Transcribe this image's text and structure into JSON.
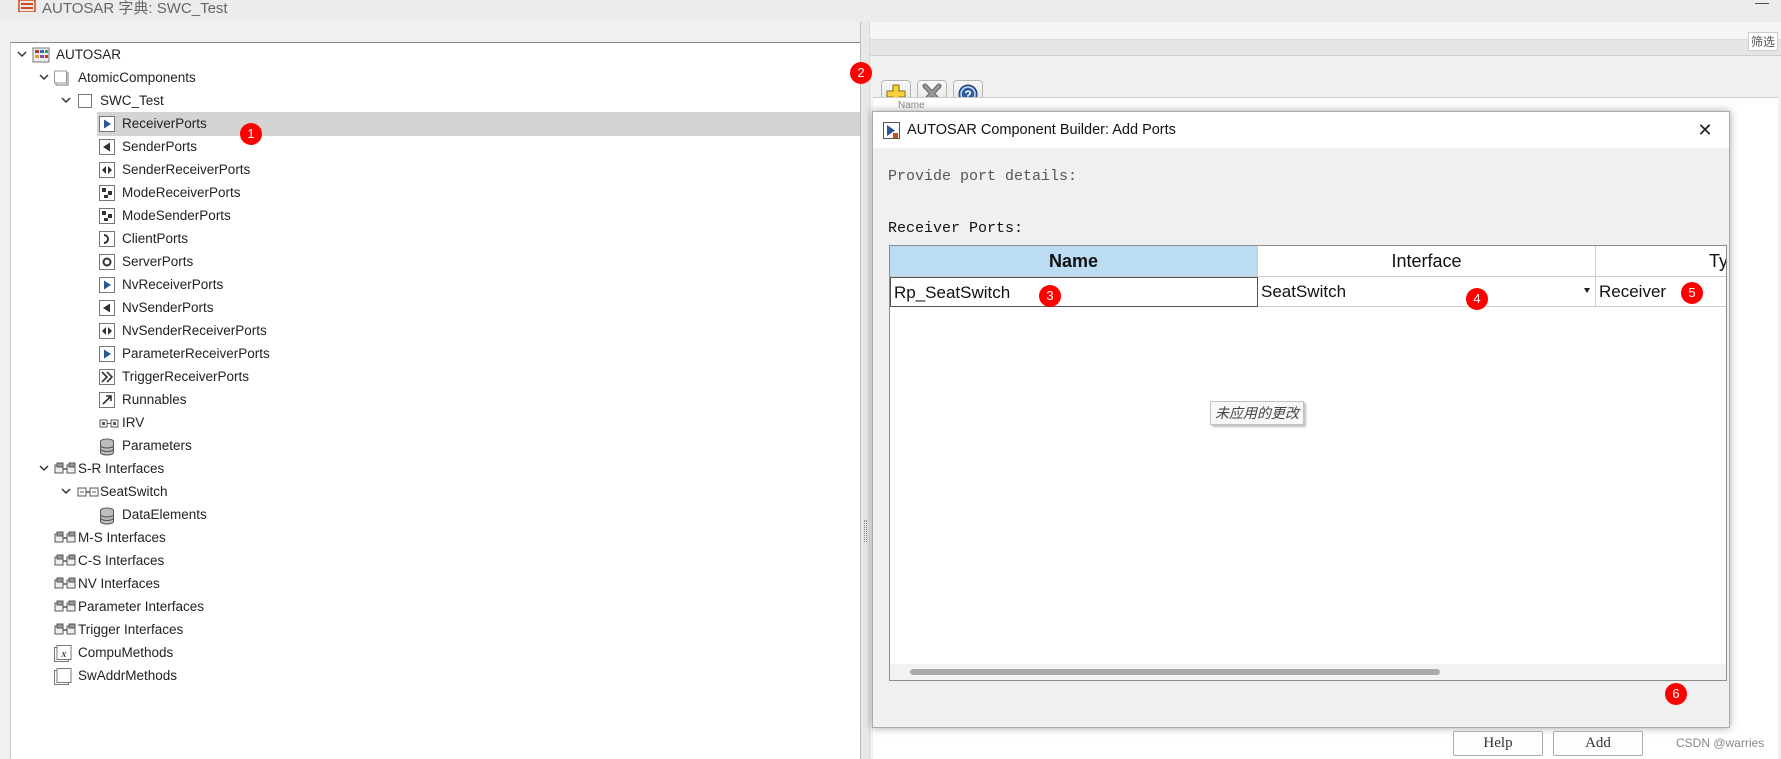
{
  "window": {
    "title": "AUTOSAR 字典: SWC_Test"
  },
  "tree": {
    "items": [
      {
        "label": "AUTOSAR",
        "depth": 0,
        "expander": "expanded",
        "icon": "autosar-root-icon",
        "selected": false
      },
      {
        "label": "AtomicComponents",
        "depth": 1,
        "expander": "expanded",
        "icon": "package-icon",
        "selected": false
      },
      {
        "label": "SWC_Test",
        "depth": 2,
        "expander": "expanded",
        "icon": "component-icon",
        "selected": false
      },
      {
        "label": "ReceiverPorts",
        "depth": 3,
        "expander": "none",
        "icon": "receiver-port-icon",
        "selected": true
      },
      {
        "label": "SenderPorts",
        "depth": 3,
        "expander": "none",
        "icon": "sender-port-icon",
        "selected": false
      },
      {
        "label": "SenderReceiverPorts",
        "depth": 3,
        "expander": "none",
        "icon": "sender-receiver-port-icon",
        "selected": false
      },
      {
        "label": "ModeReceiverPorts",
        "depth": 3,
        "expander": "none",
        "icon": "mode-port-icon",
        "selected": false
      },
      {
        "label": "ModeSenderPorts",
        "depth": 3,
        "expander": "none",
        "icon": "mode-port-icon",
        "selected": false
      },
      {
        "label": "ClientPorts",
        "depth": 3,
        "expander": "none",
        "icon": "client-port-icon",
        "selected": false
      },
      {
        "label": "ServerPorts",
        "depth": 3,
        "expander": "none",
        "icon": "server-port-icon",
        "selected": false
      },
      {
        "label": "NvReceiverPorts",
        "depth": 3,
        "expander": "none",
        "icon": "receiver-port-icon",
        "selected": false
      },
      {
        "label": "NvSenderPorts",
        "depth": 3,
        "expander": "none",
        "icon": "sender-port-icon",
        "selected": false
      },
      {
        "label": "NvSenderReceiverPorts",
        "depth": 3,
        "expander": "none",
        "icon": "sender-receiver-port-icon",
        "selected": false
      },
      {
        "label": "ParameterReceiverPorts",
        "depth": 3,
        "expander": "none",
        "icon": "receiver-port-icon",
        "selected": false
      },
      {
        "label": "TriggerReceiverPorts",
        "depth": 3,
        "expander": "none",
        "icon": "trigger-port-icon",
        "selected": false
      },
      {
        "label": "Runnables",
        "depth": 3,
        "expander": "none",
        "icon": "runnable-icon",
        "selected": false
      },
      {
        "label": "IRV",
        "depth": 3,
        "expander": "none",
        "icon": "irv-icon",
        "selected": false
      },
      {
        "label": "Parameters",
        "depth": 3,
        "expander": "none",
        "icon": "database-icon",
        "selected": false
      },
      {
        "label": "S-R Interfaces",
        "depth": 1,
        "expander": "expanded",
        "icon": "interface-group-icon",
        "selected": false
      },
      {
        "label": "SeatSwitch",
        "depth": 2,
        "expander": "expanded",
        "icon": "interface-icon",
        "selected": false
      },
      {
        "label": "DataElements",
        "depth": 3,
        "expander": "none",
        "icon": "database-icon",
        "selected": false
      },
      {
        "label": "M-S Interfaces",
        "depth": 1,
        "expander": "none",
        "icon": "interface-group-icon",
        "selected": false
      },
      {
        "label": "C-S Interfaces",
        "depth": 1,
        "expander": "none",
        "icon": "interface-group-icon",
        "selected": false
      },
      {
        "label": "NV Interfaces",
        "depth": 1,
        "expander": "none",
        "icon": "interface-group-icon",
        "selected": false
      },
      {
        "label": "Parameter Interfaces",
        "depth": 1,
        "expander": "none",
        "icon": "interface-group-icon",
        "selected": false
      },
      {
        "label": "Trigger Interfaces",
        "depth": 1,
        "expander": "none",
        "icon": "interface-group-icon",
        "selected": false
      },
      {
        "label": "CompuMethods",
        "depth": 1,
        "expander": "none",
        "icon": "compu-method-icon",
        "selected": false
      },
      {
        "label": "SwAddrMethods",
        "depth": 1,
        "expander": "none",
        "icon": "addr-method-icon",
        "selected": false
      }
    ]
  },
  "right_panel": {
    "filter_label": "筛选",
    "name_header_partial": "Name",
    "toolbar": [
      {
        "name": "add-icon",
        "tooltip": "Add"
      },
      {
        "name": "delete-icon",
        "tooltip": "Delete"
      },
      {
        "name": "help-icon",
        "tooltip": "Help"
      }
    ]
  },
  "dialog": {
    "title": "AUTOSAR Component Builder: Add Ports",
    "prompt": "Provide port details:",
    "section_label": "Receiver Ports:",
    "table": {
      "columns": [
        "Name",
        "Interface",
        "Type"
      ],
      "row": {
        "name": "Rp_SeatSwitch",
        "interface": "SeatSwitch",
        "type": "Receiver"
      }
    },
    "tooltip": "未应用的更改",
    "buttons": {
      "help": "Help",
      "add": "Add"
    }
  },
  "callouts": [
    "1",
    "2",
    "3",
    "4",
    "5",
    "6"
  ],
  "watermark": "CSDN @warries",
  "colors": {
    "callout": "#ff0000",
    "selected_row": "#d4d4d4",
    "active_header": "#bcdcf4"
  }
}
